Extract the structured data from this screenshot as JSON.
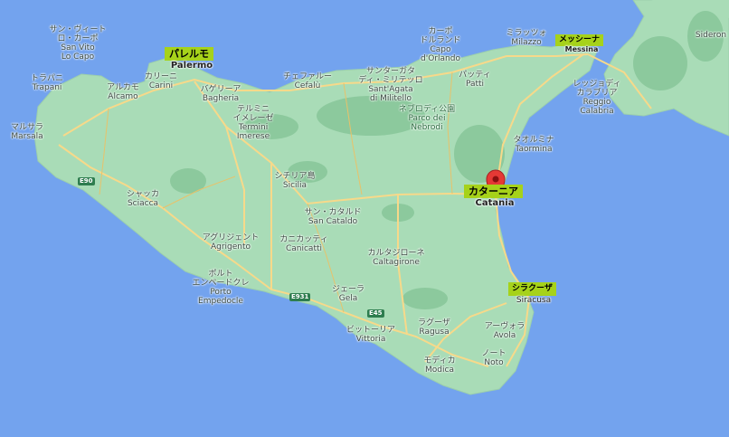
{
  "map": {
    "colors": {
      "sea": "#73a3ee",
      "land": "#a9dcb7",
      "forest": "#8cc99d",
      "road": "#f7d98a",
      "highlight": "#a6d21a",
      "pin": "#e53935"
    },
    "highlights": {
      "palermo": "パレルモ",
      "messina": "メッシーナ",
      "catania": "カターニア",
      "siracusa": "シラクーザ"
    },
    "places": {
      "san_vito": {
        "jp": "サン・ヴィート\nロ・カーポ",
        "en": "San Vito\nLo Capo"
      },
      "trapani": {
        "jp": "トラパニ",
        "en": "Trapani"
      },
      "alcamo": {
        "jp": "アルカモ",
        "en": "Alcamo"
      },
      "carini": {
        "jp": "カリーニ",
        "en": "Carini"
      },
      "palermo": {
        "en": "Palermo"
      },
      "bagheria": {
        "jp": "バゲリーア",
        "en": "Bagheria"
      },
      "marsala": {
        "jp": "マルサラ",
        "en": "Marsala"
      },
      "termini": {
        "jp": "テルミニ\nイメレーゼ",
        "en": "Termini\nImerese"
      },
      "cefalu": {
        "jp": "チェファルー",
        "en": "Cefalù"
      },
      "santagata": {
        "jp": "サンターガタ\nディ・ミリテッロ",
        "en": "Sant'Agata\ndi Militello"
      },
      "capo": {
        "jp": "カーポ\nドルランド",
        "en": "Capo\nd'Orlando"
      },
      "patti": {
        "jp": "パッティ",
        "en": "Patti"
      },
      "milazzo": {
        "jp": "ミラッツォ",
        "en": "Milazzo"
      },
      "messina": {
        "en": "Messina"
      },
      "reggio": {
        "jp": "レッジョディ\nカラブリア",
        "en": "Reggio\nCalabria"
      },
      "nebrodi": {
        "jp": "ネブロディ公園",
        "en": "Parco dei\nNebrodi"
      },
      "taormina": {
        "jp": "タオルミナ",
        "en": "Taormina"
      },
      "sicilia": {
        "jp": "シチリア島",
        "en": "Sicilia"
      },
      "sciacca": {
        "jp": "シャッカ",
        "en": "Sciacca"
      },
      "catania": {
        "en": "Catania"
      },
      "san_cataldo": {
        "jp": "サン・カタルド",
        "en": "San Cataldo"
      },
      "agrigento": {
        "jp": "アグリジェント",
        "en": "Agrigento"
      },
      "canicatti": {
        "jp": "カニカッティ",
        "en": "Canicattì"
      },
      "porto": {
        "jp": "ポルト\nエンペードクレ",
        "en": "Porto\nEmpedocle"
      },
      "caltagirone": {
        "jp": "カルタジローネ",
        "en": "Caltagirone"
      },
      "gela": {
        "jp": "ジェーラ",
        "en": "Gela"
      },
      "siracusa": {
        "en": "Siracusa"
      },
      "vittoria": {
        "jp": "ビットーリア",
        "en": "Vittoria"
      },
      "ragusa": {
        "jp": "ラグーザ",
        "en": "Ragusa"
      },
      "avola": {
        "jp": "アーヴォラ",
        "en": "Avola"
      },
      "modica": {
        "jp": "モディカ",
        "en": "Modica"
      },
      "noto": {
        "jp": "ノート",
        "en": "Noto"
      },
      "sideron": {
        "en": "Sideron"
      }
    },
    "roads": {
      "e90": "E90",
      "e931": "E931",
      "e45": "E45"
    }
  }
}
